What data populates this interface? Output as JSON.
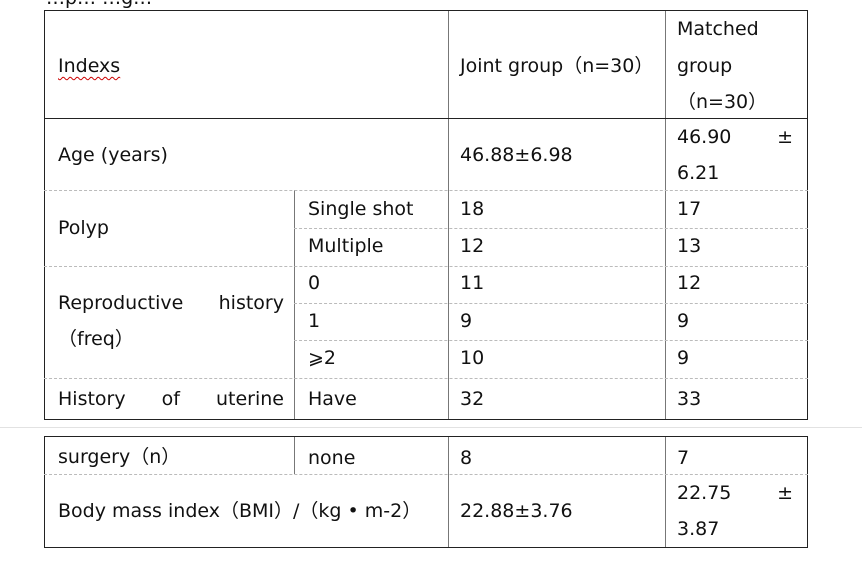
{
  "top_cut_text": "…p… …g…",
  "table": {
    "header": {
      "indexs": "Indexs",
      "joint_group": "Joint group（n=30）",
      "matched_line1": "Matched",
      "matched_line2": "group",
      "matched_line3": "（n=30）"
    },
    "age": {
      "label": "Age (years)",
      "joint": "46.88±6.98",
      "matched_a": "46.90",
      "matched_pm": "±",
      "matched_b": "6.21"
    },
    "polyp": {
      "label": "Polyp",
      "sub1": "Single shot",
      "joint1": "18",
      "matched1": "17",
      "sub2": "Multiple",
      "joint2": "12",
      "matched2": "13"
    },
    "reproductive": {
      "label_w1": "Reproductive",
      "label_w2": "history",
      "label_line2": "（freq）",
      "sub1": "0",
      "joint1": "11",
      "matched1": "12",
      "sub2": "1",
      "joint2": "9",
      "matched2": "9",
      "sub3": "⩾2",
      "joint3": "10",
      "matched3": "9"
    },
    "uterine": {
      "w1": "History",
      "w2": "of",
      "w3": "uterine",
      "sub": "Have",
      "joint": "32",
      "matched": "33"
    },
    "surgery": {
      "label": "surgery（n）",
      "sub": "none",
      "joint": "8",
      "matched": "7"
    },
    "bmi": {
      "label": "Body mass index（BMI）/（kg • m-2）",
      "joint": "22.88±3.76",
      "matched_a": "22.75",
      "matched_pm": "±",
      "matched_b": "3.87"
    }
  }
}
